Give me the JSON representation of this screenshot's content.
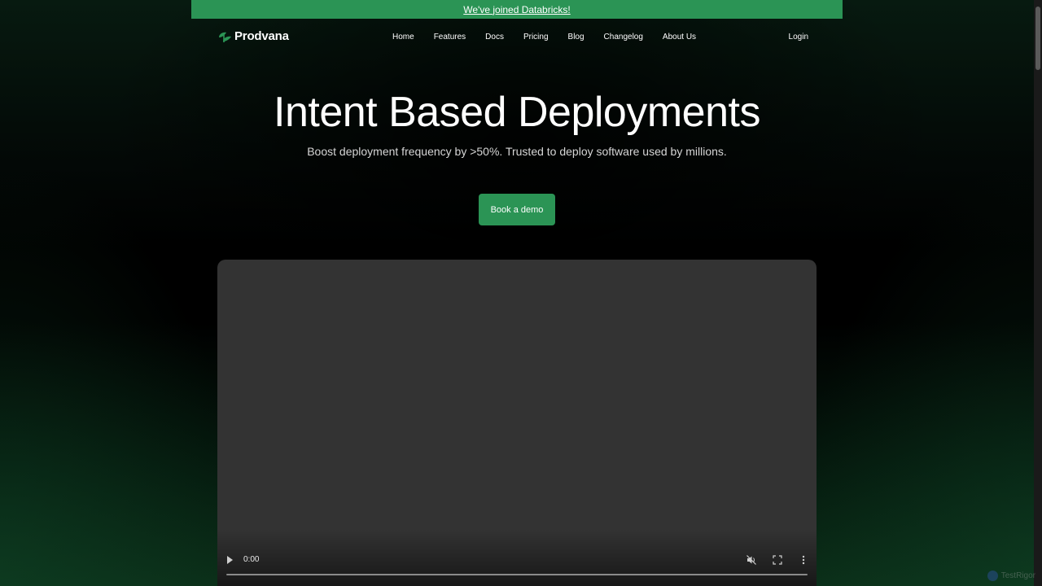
{
  "announcement": {
    "text": "We've joined Databricks!"
  },
  "brand": {
    "name": "Prodvana",
    "accent_color": "#2b9455"
  },
  "nav": {
    "items": [
      {
        "label": "Home"
      },
      {
        "label": "Features"
      },
      {
        "label": "Docs"
      },
      {
        "label": "Pricing"
      },
      {
        "label": "Blog"
      },
      {
        "label": "Changelog"
      },
      {
        "label": "About Us"
      }
    ],
    "login_label": "Login"
  },
  "hero": {
    "title": "Intent Based Deployments",
    "subtitle": "Boost deployment frequency by >50%. Trusted to deploy software used by millions.",
    "cta_label": "Book a demo"
  },
  "video": {
    "time": "0:00",
    "progress": 0,
    "muted": true,
    "controls": [
      "play-icon",
      "mute-icon",
      "fullscreen-icon",
      "more-options-icon"
    ]
  },
  "badge": {
    "text": "TestRigor"
  }
}
